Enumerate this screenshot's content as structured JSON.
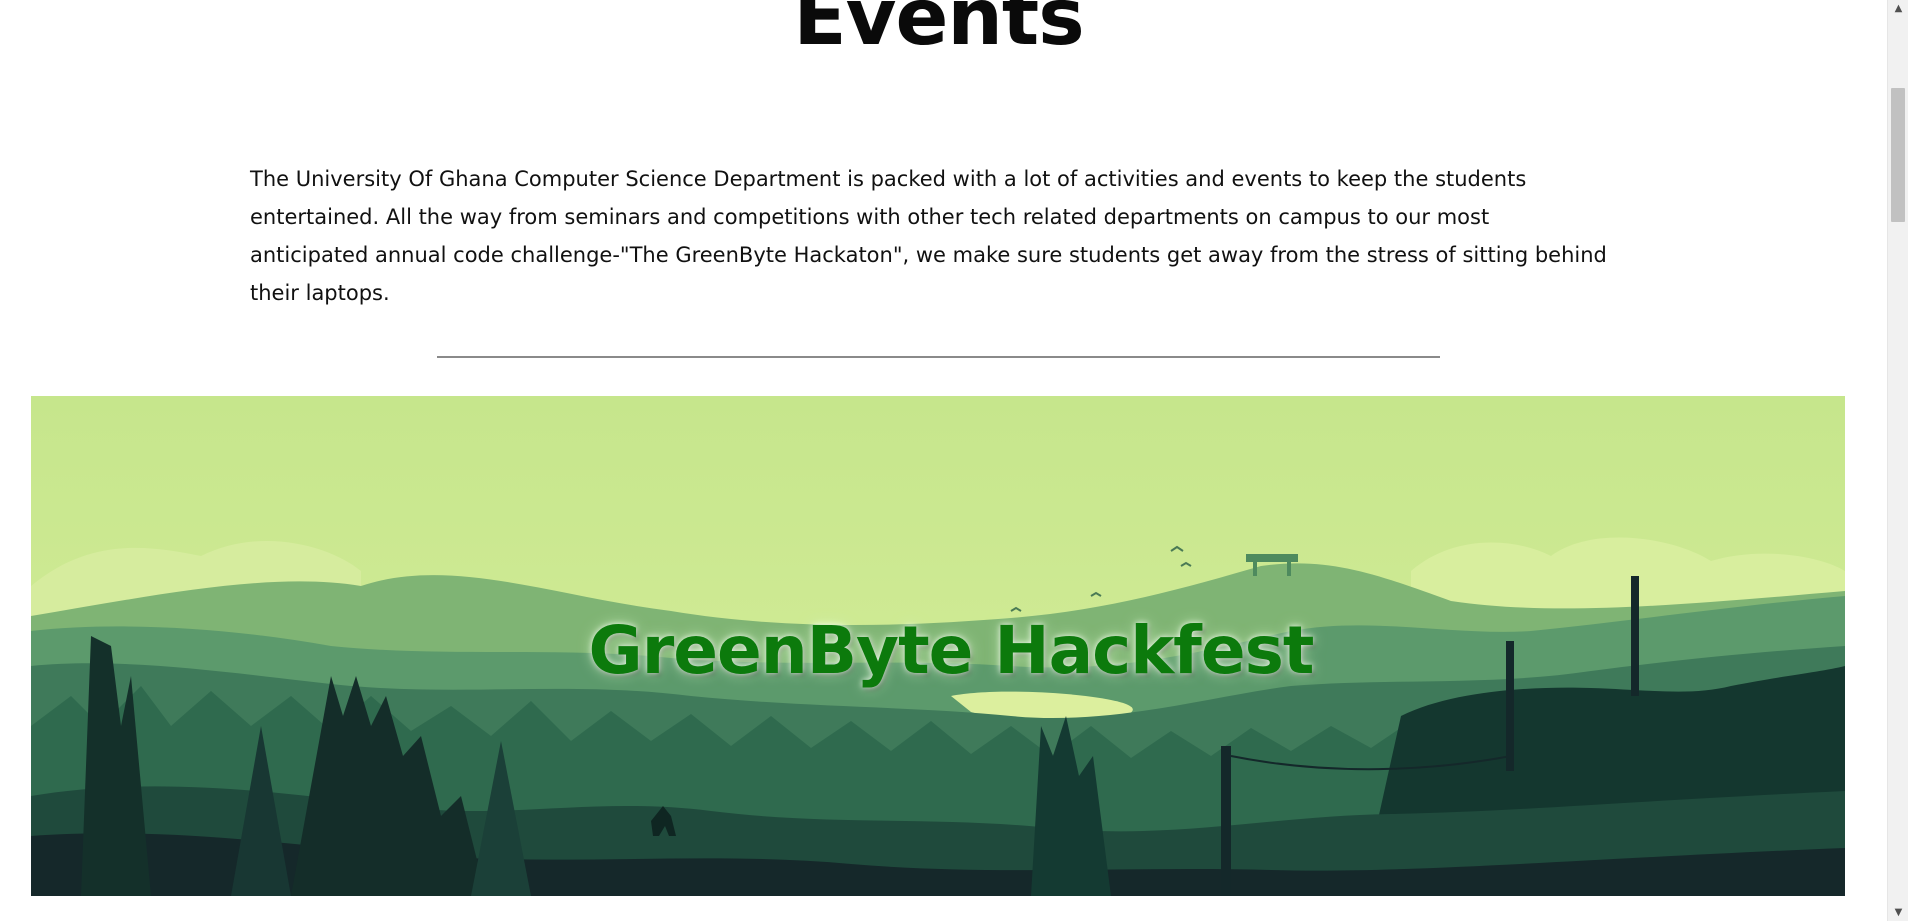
{
  "page": {
    "title": "Events",
    "intro": "The University Of Ghana Computer Science Department is packed with a lot of activities and events to keep the students entertained. All the way from seminars and competitions with other tech related departments on campus to our most anticipated annual code challenge-\"The GreenByte Hackaton\", we make sure students get away from the stress of sitting behind their laptops."
  },
  "hero": {
    "title": "GreenByte Hackfest",
    "title_color": "#0c7a0c",
    "sky_color": "#c8e690"
  },
  "scrollbar": {
    "up_icon": "scroll-up-arrow",
    "down_icon": "scroll-down-arrow"
  }
}
